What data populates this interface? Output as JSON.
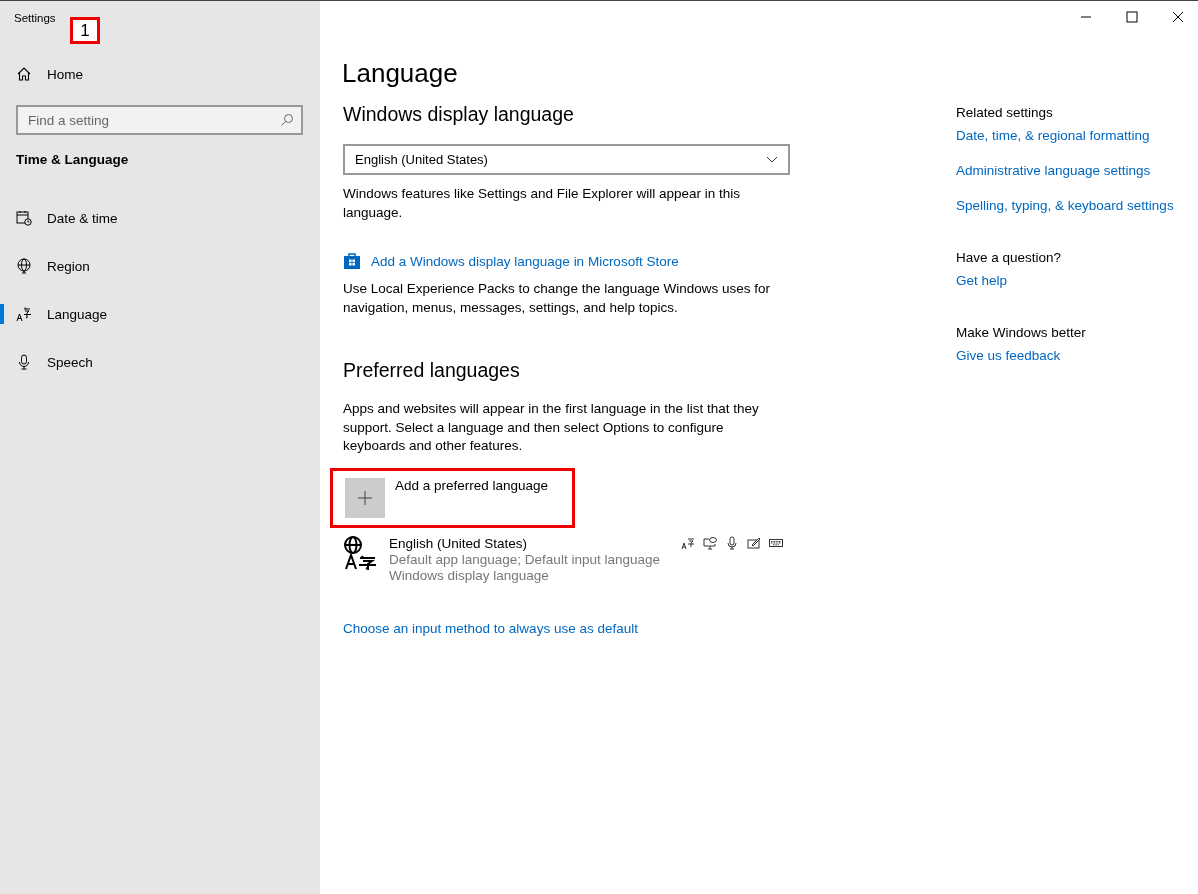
{
  "window": {
    "title": "Settings"
  },
  "annotation": {
    "label": "1"
  },
  "sidebar": {
    "home": "Home",
    "search": {
      "placeholder": "Find a setting"
    },
    "section": "Time & Language",
    "items": [
      {
        "label": "Date & time",
        "kind": "calendar",
        "selected": false
      },
      {
        "label": "Region",
        "kind": "globe",
        "selected": false
      },
      {
        "label": "Language",
        "kind": "language",
        "selected": true
      },
      {
        "label": "Speech",
        "kind": "mic",
        "selected": false
      }
    ]
  },
  "page": {
    "title": "Language",
    "display": {
      "heading": "Windows display language",
      "dropdown": "English (United States)",
      "note": "Windows features like Settings and File Explorer will appear in this language.",
      "store_link": "Add a Windows display language in Microsoft Store",
      "store_note": "Use Local Experience Packs to change the language Windows uses for navigation, menus, messages, settings, and help topics."
    },
    "preferred": {
      "heading": "Preferred languages",
      "note": "Apps and websites will appear in the first language in the list that they support. Select a language and then select Options to configure keyboards and other features.",
      "add_button": "Add a preferred language",
      "highlighted": true,
      "languages": [
        {
          "name": "English (United States)",
          "details": [
            "Default app language; Default input language",
            "Windows display language"
          ]
        }
      ]
    },
    "input_link": "Choose an input method to always use as default"
  },
  "related": [
    {
      "heading": "Related settings",
      "links": [
        "Date, time, & regional formatting",
        "Administrative language settings",
        "Spelling, typing, & keyboard settings"
      ]
    },
    {
      "heading": "Have a question?",
      "links": [
        "Get help"
      ]
    },
    {
      "heading": "Make Windows better",
      "links": [
        "Give us feedback"
      ]
    }
  ]
}
